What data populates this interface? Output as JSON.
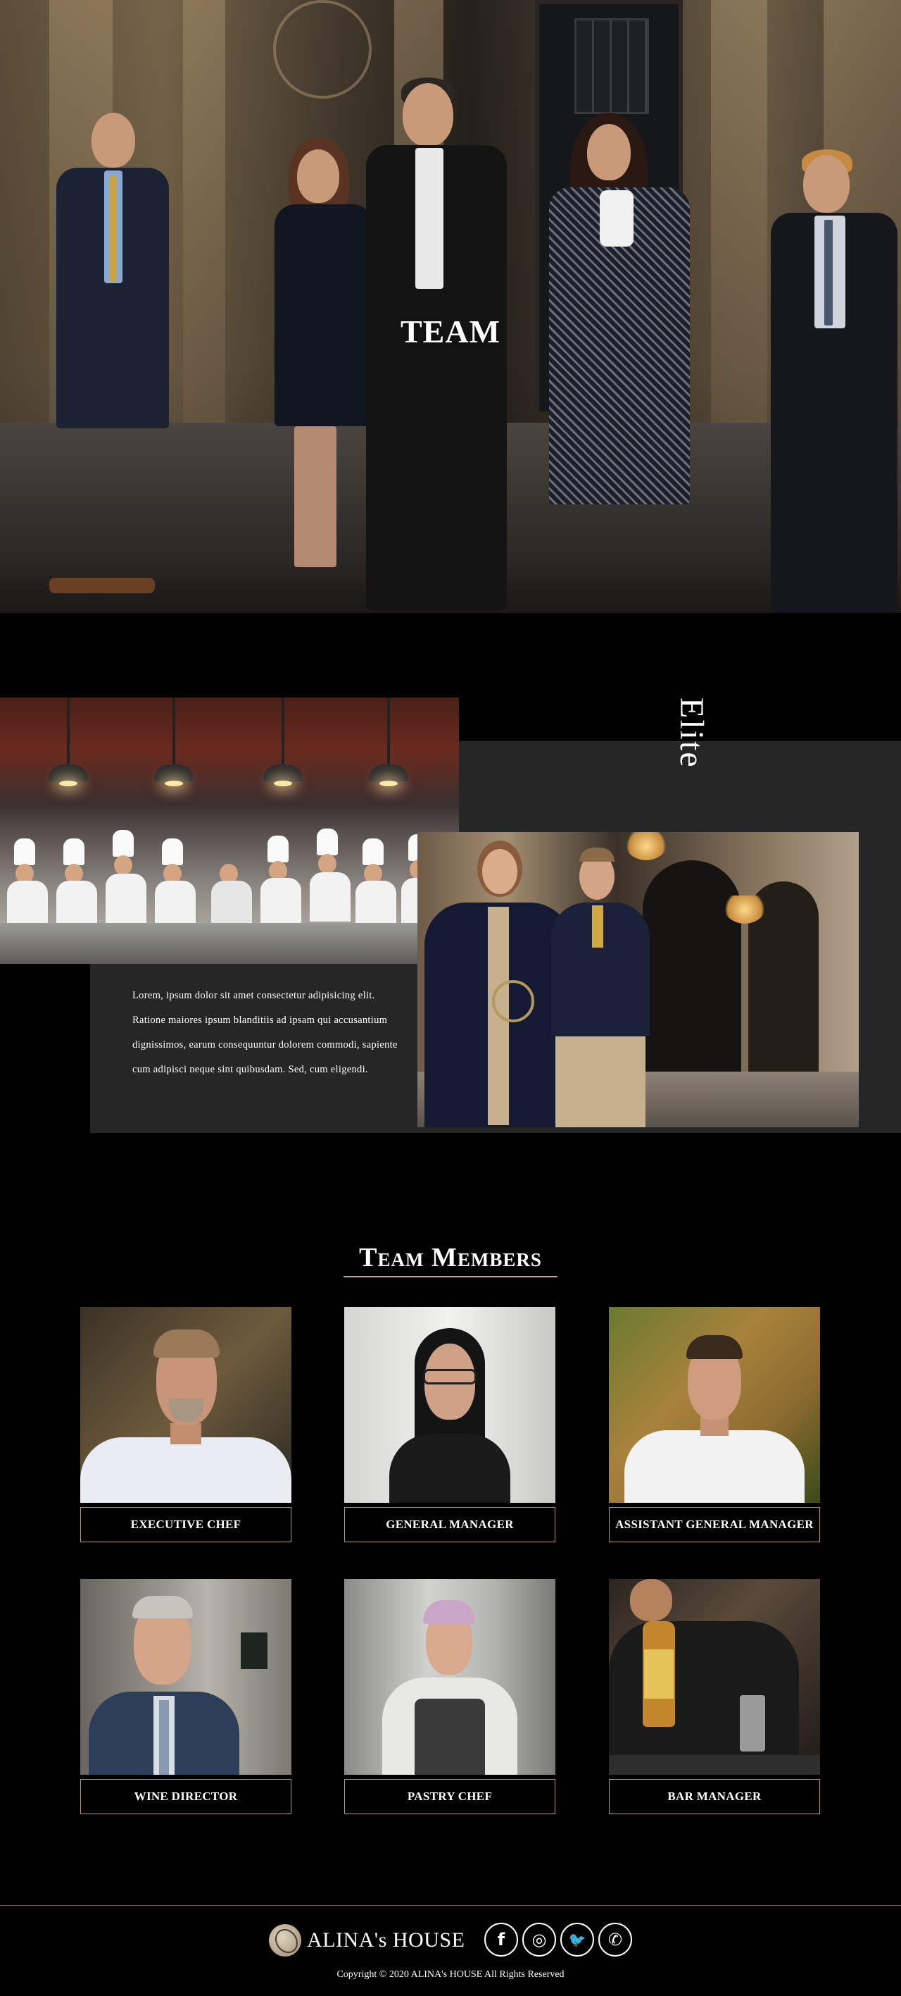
{
  "hero": {
    "title": "TEAM"
  },
  "elite": {
    "word": "Elite",
    "paragraph": "Lorem, ipsum dolor sit amet consectetur adipisicing elit. Ratione maiores ipsum blanditiis ad ipsam qui accusantium dignissimos, earum consequuntur dolorem commodi, sapiente cum adipisci neque sint quibusdam. Sed, cum eligendi."
  },
  "team_members": {
    "title": "Team Members",
    "members": [
      {
        "role": "EXECUTIVE CHEF"
      },
      {
        "role": "GENERAL MANAGER"
      },
      {
        "role": "ASSISTANT GENERAL MANAGER"
      },
      {
        "role": "WINE DIRECTOR"
      },
      {
        "role": "PASTRY CHEF"
      },
      {
        "role": "BAR MANAGER"
      }
    ]
  },
  "footer": {
    "brand": "ALINA's HOUSE",
    "socials": [
      {
        "icon": "facebook-icon",
        "glyph": "f"
      },
      {
        "icon": "instagram-icon",
        "glyph": "◎"
      },
      {
        "icon": "twitter-icon",
        "glyph": "🐦"
      },
      {
        "icon": "whatsapp-icon",
        "glyph": "✆"
      }
    ],
    "copyright": "Copyright © 2020 ALINA's HOUSE All Rights Reserved"
  },
  "colors": {
    "background": "#000000",
    "panel": "#262626",
    "accent_gold": "#b69772"
  }
}
